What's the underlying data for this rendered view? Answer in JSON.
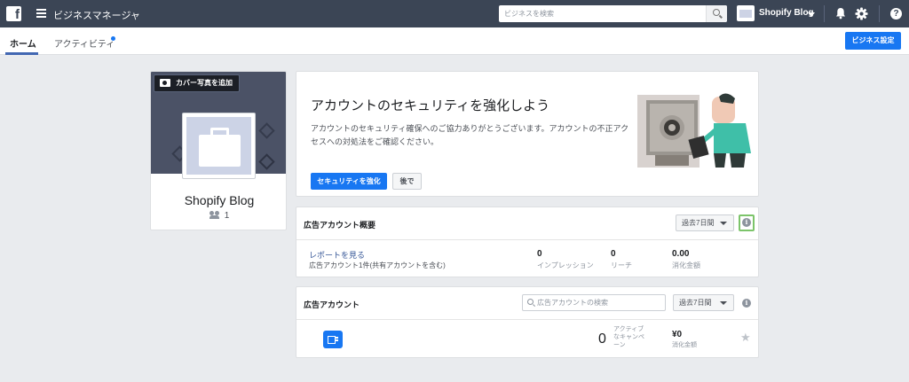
{
  "topbar": {
    "logo": "f",
    "app_title": "ビジネスマネージャ",
    "search_placeholder": "ビジネスを検索",
    "business_name": "Shopify Blog",
    "help_glyph": "?"
  },
  "tabs": {
    "home": "ホーム",
    "activity": "アクティビティ"
  },
  "settings_button": "ビジネス設定",
  "profile": {
    "cover_button": "カバー写真を追加",
    "name": "Shopify Blog",
    "people_count": "1"
  },
  "security": {
    "title": "アカウントのセキュリティを強化しよう",
    "description": "アカウントのセキュリティ確保へのご協力ありがとうございます。アカウントの不正アクセスへの対処法をご確認ください。",
    "primary_button": "セキュリティを強化",
    "later_button": "後で"
  },
  "ad_overview": {
    "title": "広告アカウント概要",
    "range": "過去7日間",
    "info_glyph": "i",
    "report_link": "レポートを見る",
    "account_summary": "広告アカウント1件(共有アカウントを含む)",
    "metrics": [
      {
        "value": "0",
        "label": "インプレッション"
      },
      {
        "value": "0",
        "label": "リーチ"
      },
      {
        "value": "0.00",
        "label": "消化金額"
      }
    ]
  },
  "ad_accounts": {
    "title": "広告アカウント",
    "search_placeholder": "広告アカウントの検索",
    "range": "過去7日間",
    "info_glyph": "i",
    "active_campaigns": "0",
    "active_campaigns_label": "アクティブなキャンペーン",
    "spend": "¥0",
    "spend_label": "消化金額",
    "star_glyph": "★"
  },
  "colors": {
    "topbar": "#3b4555",
    "primary": "#1877f2",
    "background": "#e9ebee",
    "link": "#385898",
    "highlight": "#7cc46a"
  }
}
